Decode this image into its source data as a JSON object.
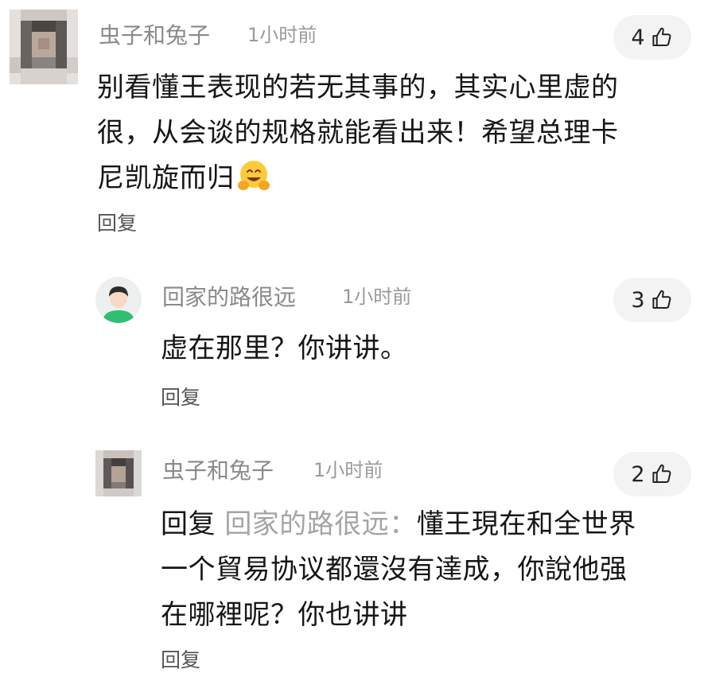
{
  "comments": [
    {
      "username": "虫子和兔子",
      "time": "1小时前",
      "likes": "4",
      "lines": [
        "别看懂王表现的若无其事的，其实心里虚的",
        "很，从会谈的规格就能看出来！希望总理卡",
        "尼凯旋而归"
      ],
      "emoji": "hugging-face",
      "reply_label": "回复"
    },
    {
      "username": "回家的路很远",
      "time": "1小时前",
      "likes": "3",
      "lines": [
        "虚在那里？你讲讲。"
      ],
      "reply_label": "回复"
    },
    {
      "username": "虫子和兔子",
      "time": "1小时前",
      "likes": "2",
      "reply_prefix": "回复",
      "reply_target": "回家的路很远：",
      "line1_rest": "懂王現在和全世界",
      "lines_rest": [
        "一个貿易协议都還沒有達成，你說他强",
        "在哪裡呢？你也讲讲"
      ],
      "reply_label": "回复"
    }
  ],
  "colors": {
    "username": "#8a8a8a",
    "text": "#161616",
    "reply_target": "#a4a4a4",
    "pill_bg": "#f3f3f3",
    "avatar_green": "#2fbf71"
  }
}
